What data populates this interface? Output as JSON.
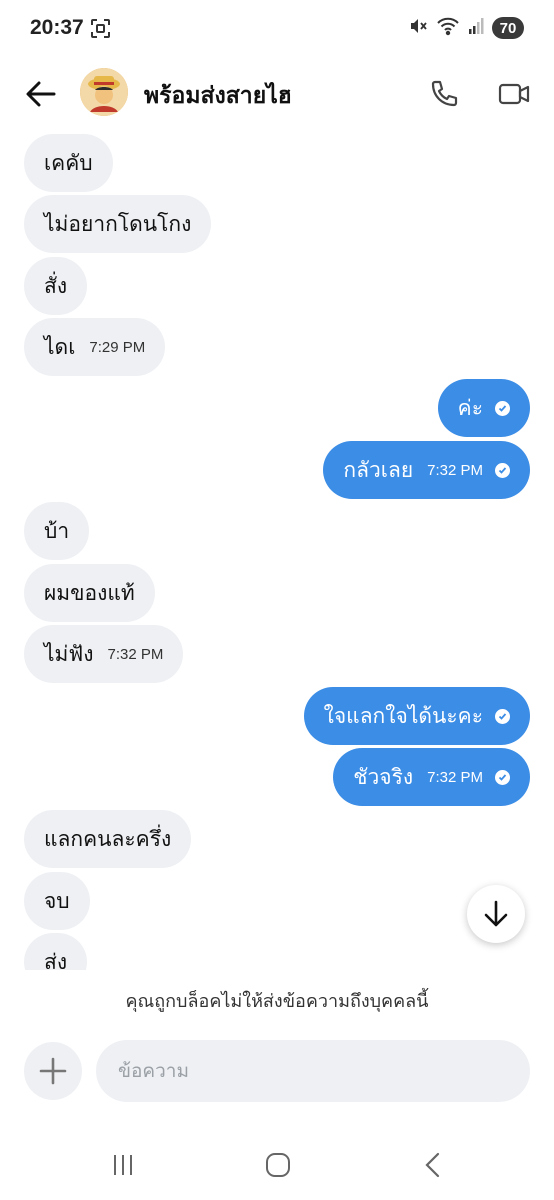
{
  "status_bar": {
    "time": "20:37",
    "battery": "70"
  },
  "header": {
    "contact_name": "พร้อมส่งสายไฮ"
  },
  "messages": [
    {
      "dir": "in",
      "text": "เคคับ",
      "time": ""
    },
    {
      "dir": "in",
      "text": "ไม่อยากโดนโกง",
      "time": ""
    },
    {
      "dir": "in",
      "text": "สั่ง",
      "time": ""
    },
    {
      "dir": "in",
      "text": "ไดเ",
      "time": "7:29 PM"
    },
    {
      "dir": "out",
      "text": "ค่ะ",
      "time": ""
    },
    {
      "dir": "out",
      "text": "กลัวเลย",
      "time": "7:32 PM"
    },
    {
      "dir": "in",
      "text": "บ้า",
      "time": ""
    },
    {
      "dir": "in",
      "text": "ผมของแท้",
      "time": ""
    },
    {
      "dir": "in",
      "text": "ไม่ฟัง",
      "time": "7:32 PM"
    },
    {
      "dir": "out",
      "text": "ใจแลกใจได้นะคะ",
      "time": ""
    },
    {
      "dir": "out",
      "text": "ชัวจริง",
      "time": "7:32 PM"
    },
    {
      "dir": "in",
      "text": "แลกคนละครึ่ง",
      "time": ""
    },
    {
      "dir": "in",
      "text": "จบ",
      "time": ""
    },
    {
      "dir": "in",
      "text": "ส่ง",
      "time": ""
    }
  ],
  "blocked_notice": "คุณถูกบล็อคไม่ให้ส่งข้อความถึงบุคคลนี้",
  "composer": {
    "placeholder": "ข้อความ"
  },
  "colors": {
    "outgoing_bubble": "#3c8de6",
    "incoming_bubble": "#eef0f3"
  }
}
